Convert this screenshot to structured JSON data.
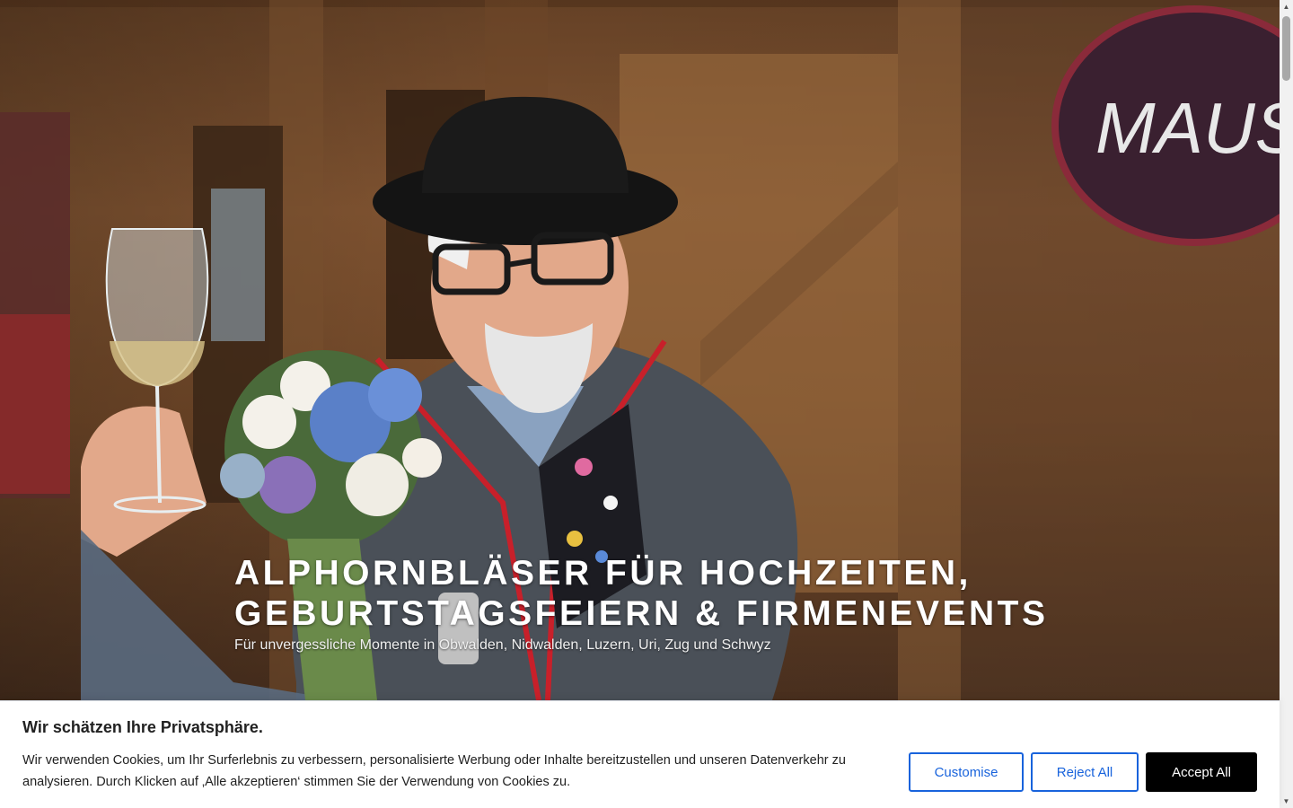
{
  "hero": {
    "title_line1": "ALPHORNBLÄSER FÜR HOCHZEITEN,",
    "title_line2": "GEBURTSTAGSFEIERN & FIRMENEVENTS",
    "subtitle": "Für unvergessliche Momente in Obwalden, Nidwalden, Luzern, Uri, Zug und Schwyz",
    "sign_text": "MAUS"
  },
  "cookie_banner": {
    "title": "Wir schätzen Ihre Privatsphäre.",
    "text": "Wir verwenden Cookies, um Ihr Surferlebnis zu verbessern, personalisierte Werbung oder Inhalte bereitzustellen und unseren Datenverkehr zu analysieren. Durch Klicken auf ‚Alle akzeptieren‘ stimmen Sie der Verwendung von Cookies zu.",
    "customise_label": "Customise",
    "reject_label": "Reject All",
    "accept_label": "Accept All"
  },
  "colors": {
    "accent": "#1863dc",
    "accept_bg": "#000000"
  }
}
